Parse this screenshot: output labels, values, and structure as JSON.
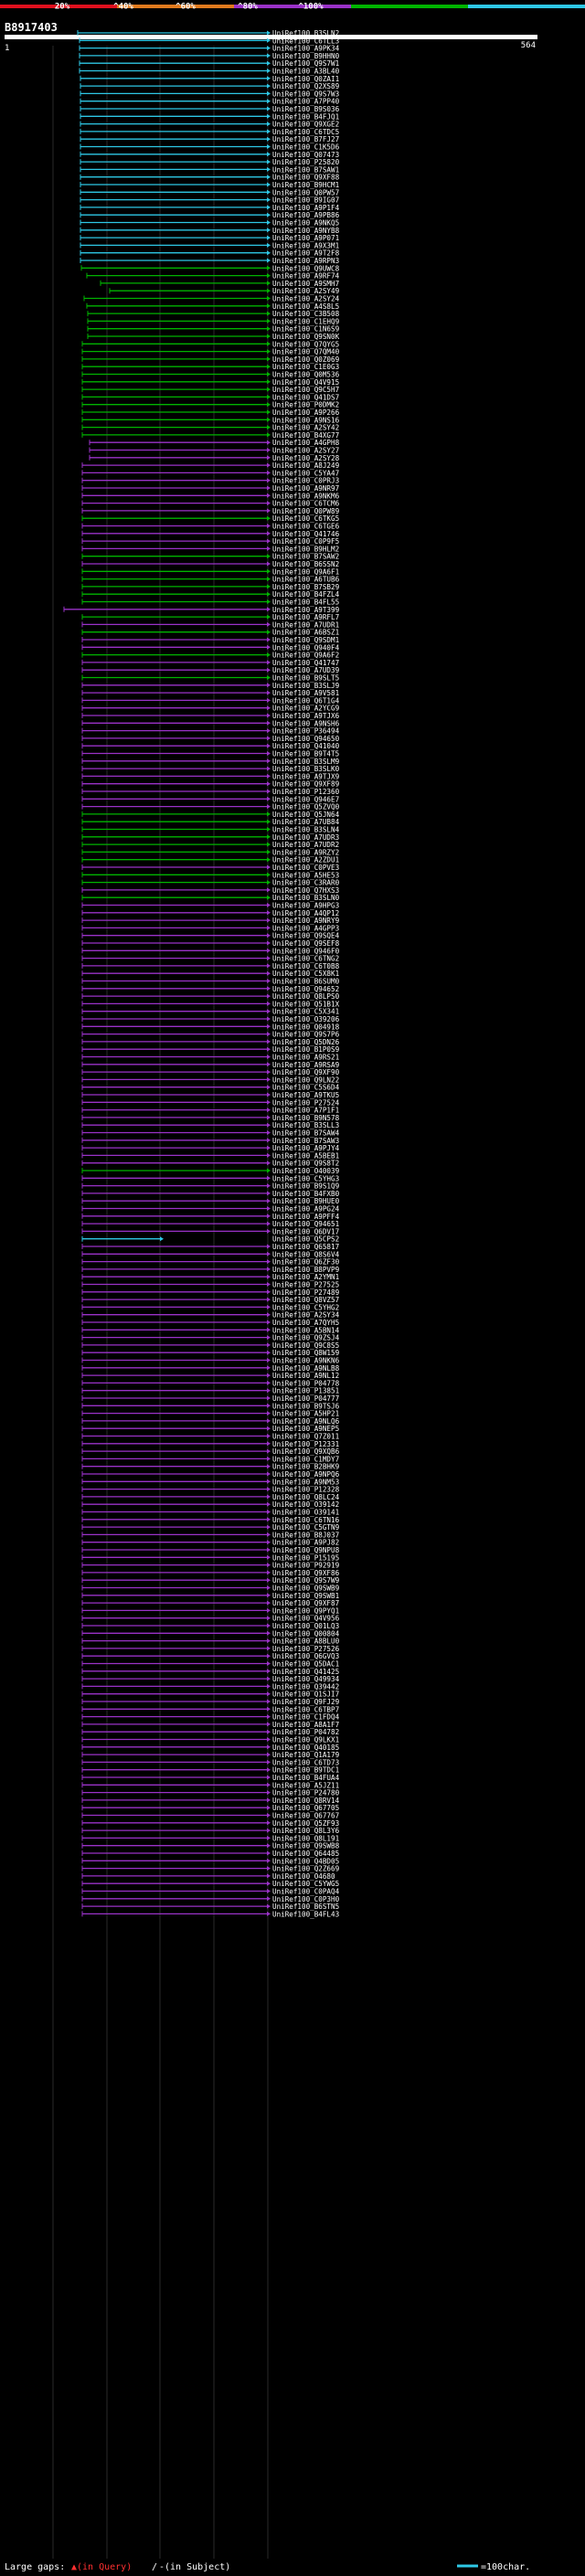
{
  "scale": {
    "ticks": [
      "20%",
      "^40%",
      "^60%",
      "^80%",
      "^100%"
    ],
    "colors": [
      "#e0101e",
      "#e07a1e",
      "#9a32c8",
      "#00b400",
      "#2ec8e6"
    ]
  },
  "query": {
    "id": "B8917403",
    "start": "1",
    "end": "564"
  },
  "legend": {
    "gaps_label": "Large gaps:",
    "in_query": "▲(in Query)",
    "sep": "/",
    "in_subject": "-(in Subject)",
    "scale_label": "=100char."
  },
  "hits": [
    {
      "id": "UniRef100_B3SLN2",
      "c": 4,
      "s": 85
    },
    {
      "id": "UniRef100_C6TLL3",
      "c": 4,
      "s": 87
    },
    {
      "id": "UniRef100_A9PK34",
      "c": 4,
      "s": 87
    },
    {
      "id": "UniRef100_B9HHN0",
      "c": 4,
      "s": 87
    },
    {
      "id": "UniRef100_Q9S7W1",
      "c": 4,
      "s": 87
    },
    {
      "id": "UniRef100_A3BL40",
      "c": 4,
      "s": 87
    },
    {
      "id": "UniRef100_Q0ZAI1",
      "c": 4,
      "s": 88
    },
    {
      "id": "UniRef100_Q2XS89",
      "c": 4,
      "s": 88
    },
    {
      "id": "UniRef100_Q9S7W3",
      "c": 4,
      "s": 88
    },
    {
      "id": "UniRef100_A7PP40",
      "c": 4,
      "s": 88
    },
    {
      "id": "UniRef100_B9S036",
      "c": 4,
      "s": 88
    },
    {
      "id": "UniRef100_B4FJQ1",
      "c": 4,
      "s": 88
    },
    {
      "id": "UniRef100_Q9XGE2",
      "c": 4,
      "s": 88
    },
    {
      "id": "UniRef100_C6TDC5",
      "c": 4,
      "s": 88
    },
    {
      "id": "UniRef100_B7FJ27",
      "c": 4,
      "s": 88
    },
    {
      "id": "UniRef100_C1K5D6",
      "c": 4,
      "s": 88
    },
    {
      "id": "UniRef100_Q07473",
      "c": 4,
      "s": 88
    },
    {
      "id": "UniRef100_P25820",
      "c": 4,
      "s": 88
    },
    {
      "id": "UniRef100_B7SAW1",
      "c": 4,
      "s": 88
    },
    {
      "id": "UniRef100_Q9XF88",
      "c": 4,
      "s": 88
    },
    {
      "id": "UniRef100_B9HCM1",
      "c": 4,
      "s": 88
    },
    {
      "id": "UniRef100_Q0PW57",
      "c": 4,
      "s": 88
    },
    {
      "id": "UniRef100_B9IG07",
      "c": 4,
      "s": 88
    },
    {
      "id": "UniRef100_A9P1F4",
      "c": 4,
      "s": 88
    },
    {
      "id": "UniRef100_A9PB86",
      "c": 4,
      "s": 88
    },
    {
      "id": "UniRef100_A9NKQ5",
      "c": 4,
      "s": 88
    },
    {
      "id": "UniRef100_A9NYB8",
      "c": 4,
      "s": 88
    },
    {
      "id": "UniRef100_A9P071",
      "c": 4,
      "s": 88
    },
    {
      "id": "UniRef100_A9X3M1",
      "c": 4,
      "s": 88
    },
    {
      "id": "UniRef100_A9T2F8",
      "c": 4,
      "s": 88
    },
    {
      "id": "UniRef100_A9RPN3",
      "c": 4,
      "s": 88
    },
    {
      "id": "UniRef100_Q9UWC8",
      "c": 3,
      "s": 89
    },
    {
      "id": "UniRef100_A9RF74",
      "c": 3,
      "s": 95
    },
    {
      "id": "UniRef100_A9SMH7",
      "c": 3,
      "s": 110
    },
    {
      "id": "UniRef100_A2SY49",
      "c": 3,
      "s": 120
    },
    {
      "id": "UniRef100_A2SY24",
      "c": 3,
      "s": 92
    },
    {
      "id": "UniRef100_A4S8L5",
      "c": 3,
      "s": 95
    },
    {
      "id": "UniRef100_C3B508",
      "c": 3,
      "s": 96
    },
    {
      "id": "UniRef100_C1EHQ9",
      "c": 3,
      "s": 96
    },
    {
      "id": "UniRef100_C1N6S9",
      "c": 3,
      "s": 96
    },
    {
      "id": "UniRef100_Q9SN0K",
      "c": 3,
      "s": 96
    },
    {
      "id": "UniRef100_Q7QYG5",
      "c": 3,
      "s": 90
    },
    {
      "id": "UniRef100_Q7QM40",
      "c": 3,
      "s": 90
    },
    {
      "id": "UniRef100_Q0Z069",
      "c": 3,
      "s": 90
    },
    {
      "id": "UniRef100_C1E0G3",
      "c": 3,
      "s": 90
    },
    {
      "id": "UniRef100_Q0M536",
      "c": 3,
      "s": 90
    },
    {
      "id": "UniRef100_Q4V915",
      "c": 3,
      "s": 90
    },
    {
      "id": "UniRef100_Q9C5H7",
      "c": 3,
      "s": 90
    },
    {
      "id": "UniRef100_Q41DS7",
      "c": 3,
      "s": 90
    },
    {
      "id": "UniRef100_P0DMK2",
      "c": 3,
      "s": 90
    },
    {
      "id": "UniRef100_A9P266",
      "c": 3,
      "s": 90
    },
    {
      "id": "UniRef100_A9NS16",
      "c": 3,
      "s": 90
    },
    {
      "id": "UniRef100_A2SY42",
      "c": 3,
      "s": 90
    },
    {
      "id": "UniRef100_B4XG77",
      "c": 3,
      "s": 90
    },
    {
      "id": "UniRef100_A4GPH8",
      "c": 2,
      "s": 98
    },
    {
      "id": "UniRef100_A2SY27",
      "c": 2,
      "s": 98
    },
    {
      "id": "UniRef100_A2SY28",
      "c": 2,
      "s": 98
    },
    {
      "id": "UniRef100_A8J249",
      "c": 2,
      "s": 90
    },
    {
      "id": "UniRef100_C5YA47",
      "c": 2,
      "s": 90
    },
    {
      "id": "UniRef100_C0PRJ3",
      "c": 2,
      "s": 90
    },
    {
      "id": "UniRef100_A9NR97",
      "c": 2,
      "s": 90
    },
    {
      "id": "UniRef100_A9NKM6",
      "c": 2,
      "s": 90
    },
    {
      "id": "UniRef100_C6TCM6",
      "c": 2,
      "s": 90
    },
    {
      "id": "UniRef100_Q0PW89",
      "c": 2,
      "s": 90
    },
    {
      "id": "UniRef100_C6TKG5",
      "c": 3,
      "s": 90
    },
    {
      "id": "UniRef100_C6TGE6",
      "c": 2,
      "s": 90
    },
    {
      "id": "UniRef100_Q41746",
      "c": 2,
      "s": 90
    },
    {
      "id": "UniRef100_C0P9F5",
      "c": 2,
      "s": 90
    },
    {
      "id": "UniRef100_B9HLM2",
      "c": 2,
      "s": 90
    },
    {
      "id": "UniRef100_B7SAW2",
      "c": 3,
      "s": 90
    },
    {
      "id": "UniRef100_B6SSN2",
      "c": 2,
      "s": 90
    },
    {
      "id": "UniRef100_Q9A6F1",
      "c": 3,
      "s": 90
    },
    {
      "id": "UniRef100_A6TUB6",
      "c": 3,
      "s": 90
    },
    {
      "id": "UniRef100_B7SB29",
      "c": 3,
      "s": 90
    },
    {
      "id": "UniRef100_B4FZL4",
      "c": 3,
      "s": 90
    },
    {
      "id": "UniRef100_B4FL55",
      "c": 3,
      "s": 90
    },
    {
      "id": "UniRef100_A9T399",
      "c": 2,
      "s": 70
    },
    {
      "id": "UniRef100_A9RFL7",
      "c": 3,
      "s": 90
    },
    {
      "id": "UniRef100_A7UDR1",
      "c": 2,
      "s": 90
    },
    {
      "id": "UniRef100_A6BSZ1",
      "c": 3,
      "s": 90
    },
    {
      "id": "UniRef100_Q9SDM1",
      "c": 2,
      "s": 90
    },
    {
      "id": "UniRef100_Q940F4",
      "c": 2,
      "s": 90
    },
    {
      "id": "UniRef100_Q9A6F2",
      "c": 3,
      "s": 90
    },
    {
      "id": "UniRef100_Q41747",
      "c": 2,
      "s": 90
    },
    {
      "id": "UniRef100_A7UD39",
      "c": 2,
      "s": 90
    },
    {
      "id": "UniRef100_B9SLT5",
      "c": 3,
      "s": 90
    },
    {
      "id": "UniRef100_B3SLJ9",
      "c": 2,
      "s": 90
    },
    {
      "id": "UniRef100_A9V581",
      "c": 2,
      "s": 90
    },
    {
      "id": "UniRef100_Q6T1G4",
      "c": 2,
      "s": 90
    },
    {
      "id": "UniRef100_A2YCG9",
      "c": 2,
      "s": 90
    },
    {
      "id": "UniRef100_A9TJX6",
      "c": 2,
      "s": 90
    },
    {
      "id": "UniRef100_A9NSH6",
      "c": 2,
      "s": 90
    },
    {
      "id": "UniRef100_P36494",
      "c": 2,
      "s": 90
    },
    {
      "id": "UniRef100_Q94650",
      "c": 2,
      "s": 90
    },
    {
      "id": "UniRef100_Q41040",
      "c": 2,
      "s": 90
    },
    {
      "id": "UniRef100_B9T4T5",
      "c": 2,
      "s": 90
    },
    {
      "id": "UniRef100_B3SLM9",
      "c": 2,
      "s": 90
    },
    {
      "id": "UniRef100_B3SLK0",
      "c": 2,
      "s": 90
    },
    {
      "id": "UniRef100_A9TJX9",
      "c": 2,
      "s": 90
    },
    {
      "id": "UniRef100_Q9XF89",
      "c": 2,
      "s": 90
    },
    {
      "id": "UniRef100_P12360",
      "c": 2,
      "s": 90
    },
    {
      "id": "UniRef100_Q946E7",
      "c": 2,
      "s": 90
    },
    {
      "id": "UniRef100_Q5ZVQ0",
      "c": 2,
      "s": 90
    },
    {
      "id": "UniRef100_Q5JN64",
      "c": 3,
      "s": 90
    },
    {
      "id": "UniRef100_A7UB84",
      "c": 3,
      "s": 90
    },
    {
      "id": "UniRef100_B3SLN4",
      "c": 3,
      "s": 90
    },
    {
      "id": "UniRef100_A7UDR3",
      "c": 3,
      "s": 90
    },
    {
      "id": "UniRef100_A7UDR2",
      "c": 3,
      "s": 90
    },
    {
      "id": "UniRef100_A9RZY2",
      "c": 3,
      "s": 90
    },
    {
      "id": "UniRef100_A2ZDU1",
      "c": 3,
      "s": 90
    },
    {
      "id": "UniRef100_C0PVE3",
      "c": 2,
      "s": 90
    },
    {
      "id": "UniRef100_A5HE53",
      "c": 3,
      "s": 90
    },
    {
      "id": "UniRef100_C3RAR0",
      "c": 3,
      "s": 90
    },
    {
      "id": "UniRef100_Q7HXS3",
      "c": 2,
      "s": 90
    },
    {
      "id": "UniRef100_B3SLN0",
      "c": 3,
      "s": 90
    },
    {
      "id": "UniRef100_A9HPG3",
      "c": 2,
      "s": 90
    },
    {
      "id": "UniRef100_A4QP12",
      "c": 2,
      "s": 90
    },
    {
      "id": "UniRef100_A9NRY9",
      "c": 2,
      "s": 90
    },
    {
      "id": "UniRef100_A4GPP3",
      "c": 2,
      "s": 90
    },
    {
      "id": "UniRef100_Q9SQE4",
      "c": 2,
      "s": 90
    },
    {
      "id": "UniRef100_Q9SEF8",
      "c": 2,
      "s": 90
    },
    {
      "id": "UniRef100_Q946F0",
      "c": 2,
      "s": 90
    },
    {
      "id": "UniRef100_C6TNG2",
      "c": 2,
      "s": 90
    },
    {
      "id": "UniRef100_C6T0B8",
      "c": 2,
      "s": 90
    },
    {
      "id": "UniRef100_C5X8K1",
      "c": 2,
      "s": 90
    },
    {
      "id": "UniRef100_B6SUM0",
      "c": 2,
      "s": 90
    },
    {
      "id": "UniRef100_Q94652",
      "c": 2,
      "s": 90
    },
    {
      "id": "UniRef100_Q8LPS0",
      "c": 2,
      "s": 90
    },
    {
      "id": "UniRef100_Q51B1X",
      "c": 2,
      "s": 90
    },
    {
      "id": "UniRef100_C5X341",
      "c": 2,
      "s": 90
    },
    {
      "id": "UniRef100_O39206",
      "c": 2,
      "s": 90
    },
    {
      "id": "UniRef100_Q04918",
      "c": 2,
      "s": 90
    },
    {
      "id": "UniRef100_Q9S7P6",
      "c": 2,
      "s": 90
    },
    {
      "id": "UniRef100_Q5DN26",
      "c": 2,
      "s": 90
    },
    {
      "id": "UniRef100_B1P0S9",
      "c": 2,
      "s": 90
    },
    {
      "id": "UniRef100_A9RS21",
      "c": 2,
      "s": 90
    },
    {
      "id": "UniRef100_A9RSA9",
      "c": 2,
      "s": 90
    },
    {
      "id": "UniRef100_Q9XF90",
      "c": 2,
      "s": 90
    },
    {
      "id": "UniRef100_Q9LN22",
      "c": 2,
      "s": 90
    },
    {
      "id": "UniRef100_C5S6D4",
      "c": 2,
      "s": 90
    },
    {
      "id": "UniRef100_A9TKU5",
      "c": 2,
      "s": 90
    },
    {
      "id": "UniRef100_P27524",
      "c": 2,
      "s": 90
    },
    {
      "id": "UniRef100_A7P1F1",
      "c": 2,
      "s": 90
    },
    {
      "id": "UniRef100_B9N578",
      "c": 2,
      "s": 90
    },
    {
      "id": "UniRef100_B3SLL3",
      "c": 2,
      "s": 90
    },
    {
      "id": "UniRef100_B7SAW4",
      "c": 2,
      "s": 90
    },
    {
      "id": "UniRef100_B7SAW3",
      "c": 2,
      "s": 90
    },
    {
      "id": "UniRef100_A9PJY4",
      "c": 2,
      "s": 90
    },
    {
      "id": "UniRef100_A5BEB1",
      "c": 2,
      "s": 90
    },
    {
      "id": "UniRef100_Q9S8T2",
      "c": 2,
      "s": 90
    },
    {
      "id": "UniRef100_O40039",
      "c": 3,
      "s": 90
    },
    {
      "id": "UniRef100_C5YHG3",
      "c": 2,
      "s": 90
    },
    {
      "id": "UniRef100_B9S1Q9",
      "c": 2,
      "s": 90
    },
    {
      "id": "UniRef100_B4FXB0",
      "c": 2,
      "s": 90
    },
    {
      "id": "UniRef100_B9HUE0",
      "c": 2,
      "s": 90
    },
    {
      "id": "UniRef100_A9PG24",
      "c": 2,
      "s": 90
    },
    {
      "id": "UniRef100_A9PFF4",
      "c": 2,
      "s": 90
    },
    {
      "id": "UniRef100_Q94651",
      "c": 2,
      "s": 90
    },
    {
      "id": "UniRef100_Q6DV17",
      "c": 2,
      "s": 90
    },
    {
      "id": "UniRef100_Q5CPS2",
      "c": 4,
      "s": 90,
      "e": 175
    },
    {
      "id": "UniRef100_Q65817",
      "c": 2,
      "s": 90
    },
    {
      "id": "UniRef100_Q8S6V4",
      "c": 2,
      "s": 90
    },
    {
      "id": "UniRef100_Q6ZF30",
      "c": 2,
      "s": 90
    },
    {
      "id": "UniRef100_B8PVP9",
      "c": 2,
      "s": 90
    },
    {
      "id": "UniRef100_A2YMN1",
      "c": 2,
      "s": 90
    },
    {
      "id": "UniRef100_P27525",
      "c": 2,
      "s": 90
    },
    {
      "id": "UniRef100_P27489",
      "c": 2,
      "s": 90
    },
    {
      "id": "UniRef100_Q8VZ57",
      "c": 2,
      "s": 90
    },
    {
      "id": "UniRef100_C5YHG2",
      "c": 2,
      "s": 90
    },
    {
      "id": "UniRef100_A2SY34",
      "c": 2,
      "s": 90
    },
    {
      "id": "UniRef100_A7QYH5",
      "c": 2,
      "s": 90
    },
    {
      "id": "UniRef100_A5BN14",
      "c": 2,
      "s": 90
    },
    {
      "id": "UniRef100_Q9ZSJ4",
      "c": 2,
      "s": 90
    },
    {
      "id": "UniRef100_Q9C8S5",
      "c": 2,
      "s": 90
    },
    {
      "id": "UniRef100_Q8W159",
      "c": 2,
      "s": 90
    },
    {
      "id": "UniRef100_A9NKN6",
      "c": 2,
      "s": 90
    },
    {
      "id": "UniRef100_A9NLB8",
      "c": 2,
      "s": 90
    },
    {
      "id": "UniRef100_A9NL12",
      "c": 2,
      "s": 90
    },
    {
      "id": "UniRef100_P04778",
      "c": 2,
      "s": 90
    },
    {
      "id": "UniRef100_P13851",
      "c": 2,
      "s": 90
    },
    {
      "id": "UniRef100_P04777",
      "c": 2,
      "s": 90
    },
    {
      "id": "UniRef100_B9TSJ6",
      "c": 2,
      "s": 90
    },
    {
      "id": "UniRef100_A5HP21",
      "c": 2,
      "s": 90
    },
    {
      "id": "UniRef100_A9NLQ6",
      "c": 2,
      "s": 90
    },
    {
      "id": "UniRef100_A9NEP5",
      "c": 2,
      "s": 90
    },
    {
      "id": "UniRef100_Q7Z011",
      "c": 2,
      "s": 90
    },
    {
      "id": "UniRef100_P12331",
      "c": 2,
      "s": 90
    },
    {
      "id": "UniRef100_Q9XQB6",
      "c": 2,
      "s": 90
    },
    {
      "id": "UniRef100_C1MDY7",
      "c": 2,
      "s": 90
    },
    {
      "id": "UniRef100_B2BHK9",
      "c": 2,
      "s": 90
    },
    {
      "id": "UniRef100_A9NPQ6",
      "c": 2,
      "s": 90
    },
    {
      "id": "UniRef100_A9NM53",
      "c": 2,
      "s": 90
    },
    {
      "id": "UniRef100_P12328",
      "c": 2,
      "s": 90
    },
    {
      "id": "UniRef100_Q8LC24",
      "c": 2,
      "s": 90
    },
    {
      "id": "UniRef100_O39142",
      "c": 2,
      "s": 90
    },
    {
      "id": "UniRef100_O39141",
      "c": 2,
      "s": 90
    },
    {
      "id": "UniRef100_C6TN16",
      "c": 2,
      "s": 90
    },
    {
      "id": "UniRef100_C5GTN9",
      "c": 2,
      "s": 90
    },
    {
      "id": "UniRef100_B8J037",
      "c": 2,
      "s": 90
    },
    {
      "id": "UniRef100_A9PJ82",
      "c": 2,
      "s": 90
    },
    {
      "id": "UniRef100_Q9NPU8",
      "c": 2,
      "s": 90
    },
    {
      "id": "UniRef100_P15195",
      "c": 2,
      "s": 90
    },
    {
      "id": "UniRef100_P92919",
      "c": 2,
      "s": 90
    },
    {
      "id": "UniRef100_Q9XF86",
      "c": 2,
      "s": 90
    },
    {
      "id": "UniRef100_Q9S7W9",
      "c": 2,
      "s": 90
    },
    {
      "id": "UniRef100_Q9SWB9",
      "c": 2,
      "s": 90
    },
    {
      "id": "UniRef100_Q9SWB1",
      "c": 2,
      "s": 90
    },
    {
      "id": "UniRef100_Q9XF87",
      "c": 2,
      "s": 90
    },
    {
      "id": "UniRef100_Q9PYQ1",
      "c": 2,
      "s": 90
    },
    {
      "id": "UniRef100_Q4V956",
      "c": 2,
      "s": 90
    },
    {
      "id": "UniRef100_Q01LQ3",
      "c": 2,
      "s": 90
    },
    {
      "id": "UniRef100_Q00804",
      "c": 2,
      "s": 90
    },
    {
      "id": "UniRef100_A8BLU0",
      "c": 2,
      "s": 90
    },
    {
      "id": "UniRef100_P27526",
      "c": 2,
      "s": 90
    },
    {
      "id": "UniRef100_Q6GVQ3",
      "c": 2,
      "s": 90
    },
    {
      "id": "UniRef100_Q5DAC1",
      "c": 2,
      "s": 90
    },
    {
      "id": "UniRef100_Q41425",
      "c": 2,
      "s": 90
    },
    {
      "id": "UniRef100_Q49934",
      "c": 2,
      "s": 90
    },
    {
      "id": "UniRef100_Q39442",
      "c": 2,
      "s": 90
    },
    {
      "id": "UniRef100_Q1SJI7",
      "c": 2,
      "s": 90
    },
    {
      "id": "UniRef100_Q9FJ29",
      "c": 2,
      "s": 90
    },
    {
      "id": "UniRef100_C6TBP7",
      "c": 2,
      "s": 90
    },
    {
      "id": "UniRef100_C1FDQ4",
      "c": 2,
      "s": 90
    },
    {
      "id": "UniRef100_A8A1F7",
      "c": 2,
      "s": 90
    },
    {
      "id": "UniRef100_P04782",
      "c": 2,
      "s": 90
    },
    {
      "id": "UniRef100_Q9LKX1",
      "c": 2,
      "s": 90
    },
    {
      "id": "UniRef100_Q40185",
      "c": 2,
      "s": 90
    },
    {
      "id": "UniRef100_Q1A179",
      "c": 2,
      "s": 90
    },
    {
      "id": "UniRef100_C6TD73",
      "c": 2,
      "s": 90
    },
    {
      "id": "UniRef100_B9TDC1",
      "c": 2,
      "s": 90
    },
    {
      "id": "UniRef100_B4FUA4",
      "c": 2,
      "s": 90
    },
    {
      "id": "UniRef100_A5JZ11",
      "c": 2,
      "s": 90
    },
    {
      "id": "UniRef100_P24780",
      "c": 2,
      "s": 90
    },
    {
      "id": "UniRef100_Q8RV14",
      "c": 2,
      "s": 90
    },
    {
      "id": "UniRef100_Q67705",
      "c": 2,
      "s": 90
    },
    {
      "id": "UniRef100_Q67767",
      "c": 2,
      "s": 90
    },
    {
      "id": "UniRef100_Q5ZF93",
      "c": 2,
      "s": 90
    },
    {
      "id": "UniRef100_Q8L3Y6",
      "c": 2,
      "s": 90
    },
    {
      "id": "UniRef100_Q8L191",
      "c": 2,
      "s": 90
    },
    {
      "id": "UniRef100_Q9SWB8",
      "c": 2,
      "s": 90
    },
    {
      "id": "UniRef100_Q64485",
      "c": 2,
      "s": 90
    },
    {
      "id": "UniRef100_Q4BD05",
      "c": 2,
      "s": 90
    },
    {
      "id": "UniRef100_Q2Z669",
      "c": 2,
      "s": 90
    },
    {
      "id": "UniRef100_O4680",
      "c": 2,
      "s": 90
    },
    {
      "id": "UniRef100_C5YWG5",
      "c": 2,
      "s": 90
    },
    {
      "id": "UniRef100_C0PAQ4",
      "c": 2,
      "s": 90
    },
    {
      "id": "UniRef100_C0P3H0",
      "c": 2,
      "s": 90
    },
    {
      "id": "UniRef100_B6STN5",
      "c": 2,
      "s": 90
    },
    {
      "id": "UniRef100_B4FL43",
      "c": 2,
      "s": 90
    }
  ]
}
